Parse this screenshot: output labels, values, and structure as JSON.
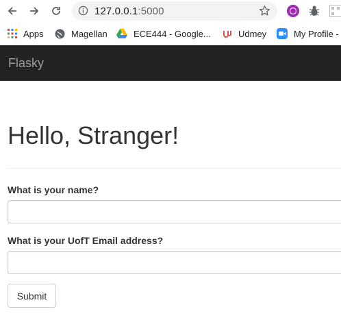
{
  "browser": {
    "url_host": "127.0.0.1",
    "url_port": ":5000"
  },
  "bookmarks": [
    {
      "label": "Apps",
      "icon": "apps-grid-icon"
    },
    {
      "label": "Magellan",
      "icon": "globe-icon"
    },
    {
      "label": "ECE444 - Google...",
      "icon": "google-drive-icon"
    },
    {
      "label": "Udmey",
      "icon": "udemy-icon"
    },
    {
      "label": "My Profile -",
      "icon": "zoom-icon"
    }
  ],
  "navbar": {
    "brand": "Flasky"
  },
  "page": {
    "heading": "Hello, Stranger!"
  },
  "form": {
    "name_label": "What is your name?",
    "name_value": "",
    "email_label": "What is your UofT Email address?",
    "email_value": "",
    "submit_label": "Submit"
  },
  "colors": {
    "navbar_bg": "#222222",
    "brand_text": "#9d9d9d",
    "heading_text": "#333333"
  }
}
